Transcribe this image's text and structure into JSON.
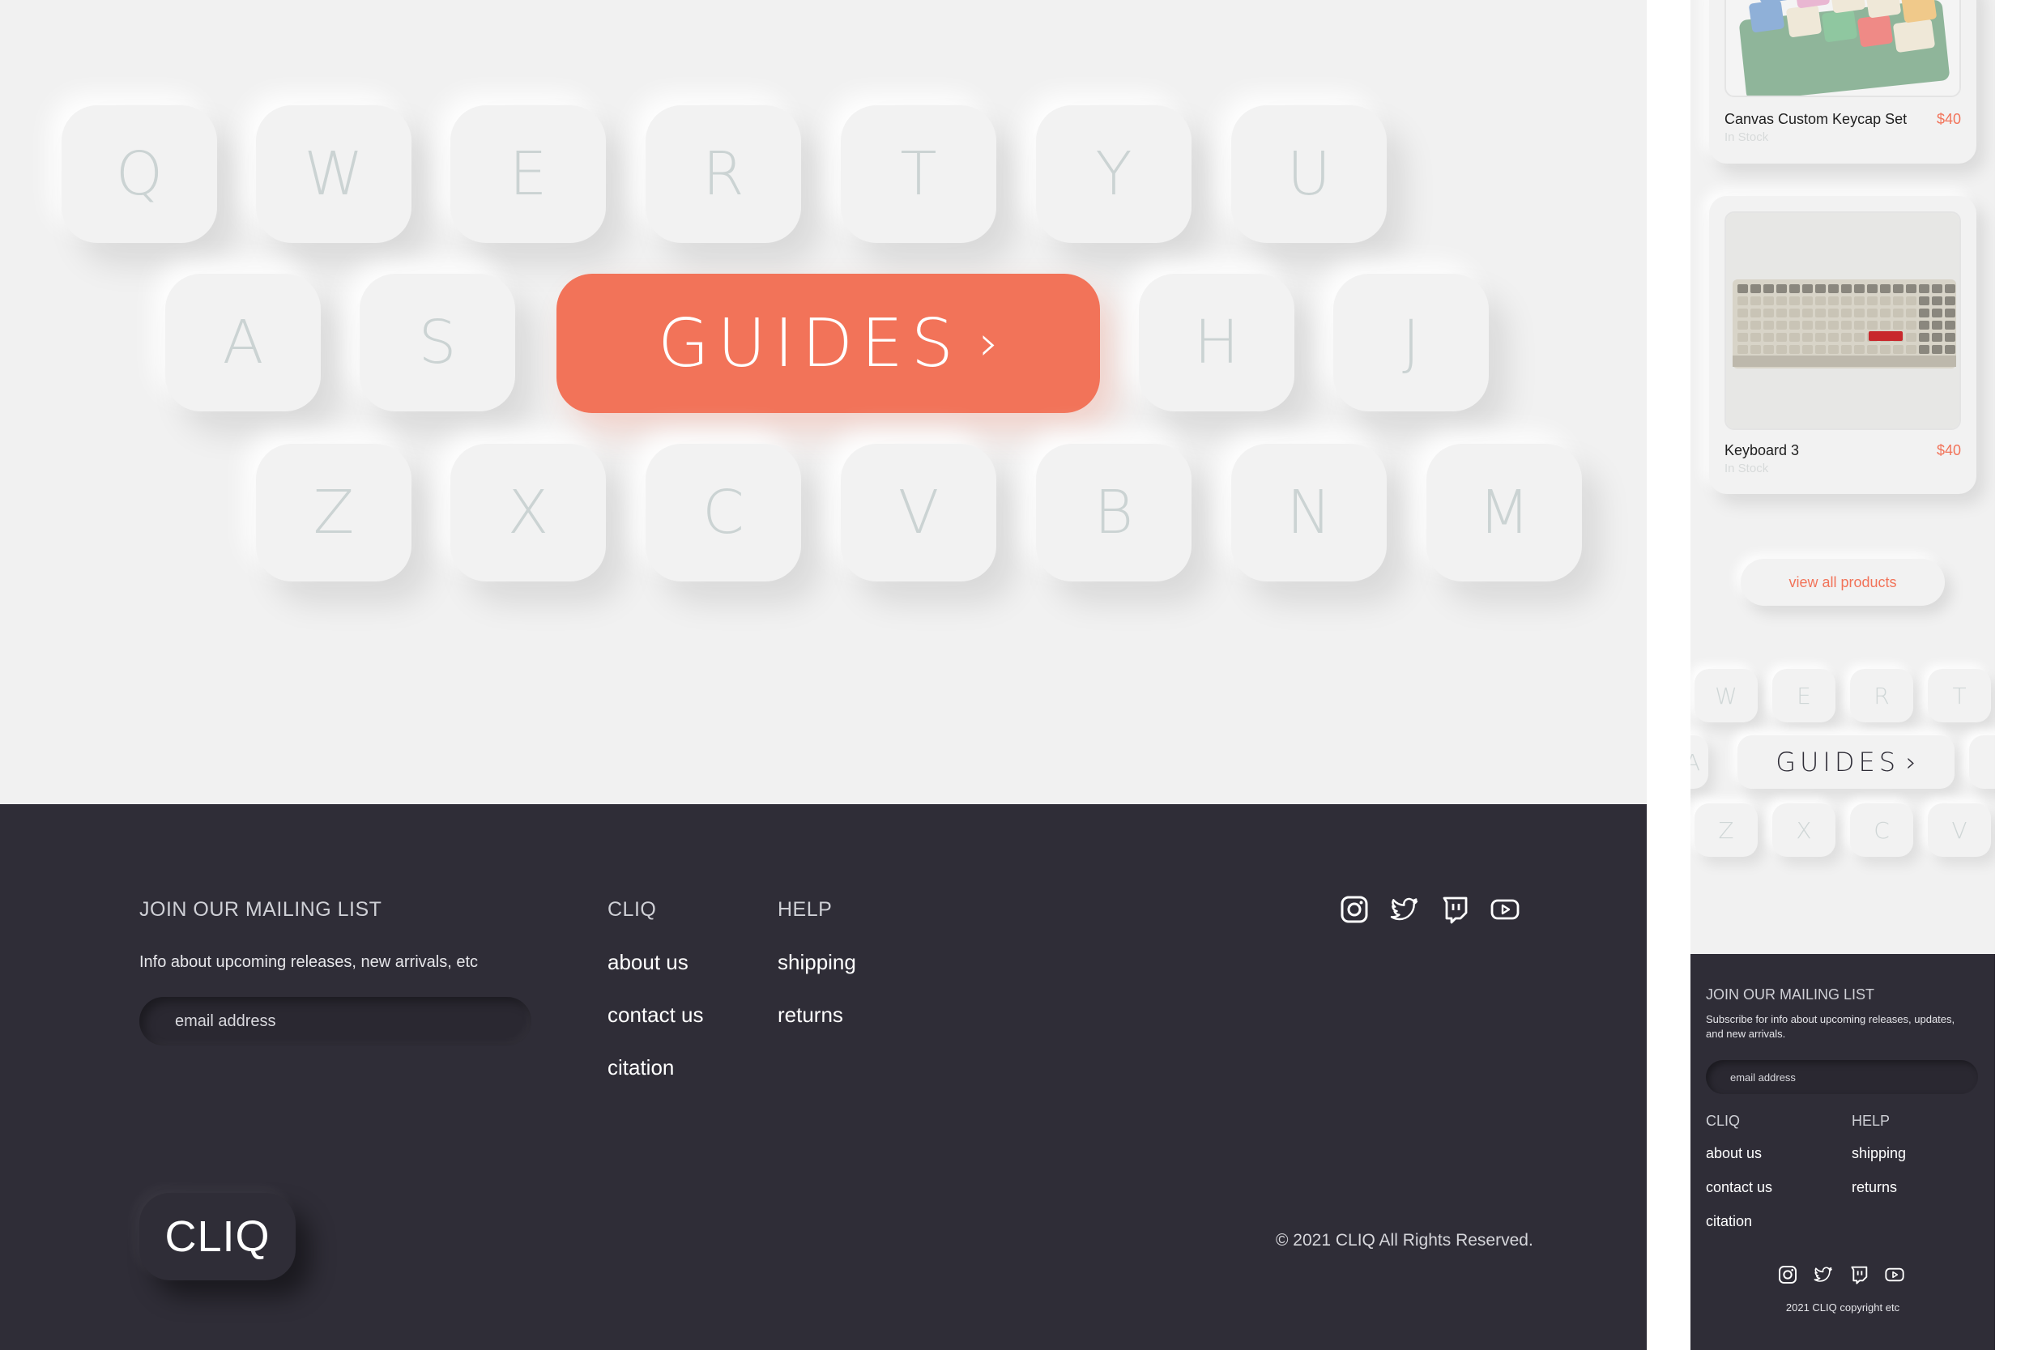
{
  "colors": {
    "accent": "#f27359",
    "footer_bg": "#2f2d37",
    "page_bg": "#f1f1f1",
    "key_text": "#cbd3d3"
  },
  "keyboard": {
    "row1": [
      "Q",
      "W",
      "E",
      "R",
      "T",
      "Y",
      "U"
    ],
    "row2_left": [
      "A",
      "S"
    ],
    "row2_right": [
      "H",
      "J"
    ],
    "row3": [
      "Z",
      "X",
      "C",
      "V",
      "B",
      "N",
      "M"
    ],
    "guides_label": "GUIDES",
    "guides_chevron": "›"
  },
  "footer": {
    "mailing_heading": "JOIN OUR MAILING LIST",
    "mailing_text": "Info about upcoming releases, new arrivals, etc",
    "email_placeholder": "email address",
    "cliq_heading": "CLIQ",
    "cliq_links": [
      "about us",
      "contact us",
      "citation"
    ],
    "help_heading": "HELP",
    "help_links": [
      "shipping",
      "returns"
    ],
    "social_icons": [
      "instagram-icon",
      "twitter-icon",
      "twitch-icon",
      "youtube-icon"
    ],
    "logo_text": "CLIQ",
    "copyright": "© 2021 CLIQ All Rights Reserved."
  },
  "mobile": {
    "products": [
      {
        "name": "Canvas Custom Keycap Set",
        "price": "$40",
        "stock": "In Stock"
      },
      {
        "name": "Keyboard 3",
        "price": "$40",
        "stock": "In Stock"
      }
    ],
    "view_all_label": "view all products",
    "keys_row1": [
      "W",
      "E",
      "R",
      "T"
    ],
    "keys_row2_left": "A",
    "keys_row3": [
      "Z",
      "X",
      "C",
      "V"
    ],
    "guides_label": "GUIDES",
    "guides_chevron": "›",
    "footer": {
      "mailing_heading": "JOIN OUR MAILING LIST",
      "mailing_text": "Subscribe for info about upcoming releases, updates, and new arrivals.",
      "email_placeholder": "email address",
      "cliq_heading": "CLIQ",
      "cliq_links": [
        "about us",
        "contact us",
        "citation"
      ],
      "help_heading": "HELP",
      "help_links": [
        "shipping",
        "returns"
      ],
      "copyright": "2021 CLIQ copyright etc"
    }
  }
}
